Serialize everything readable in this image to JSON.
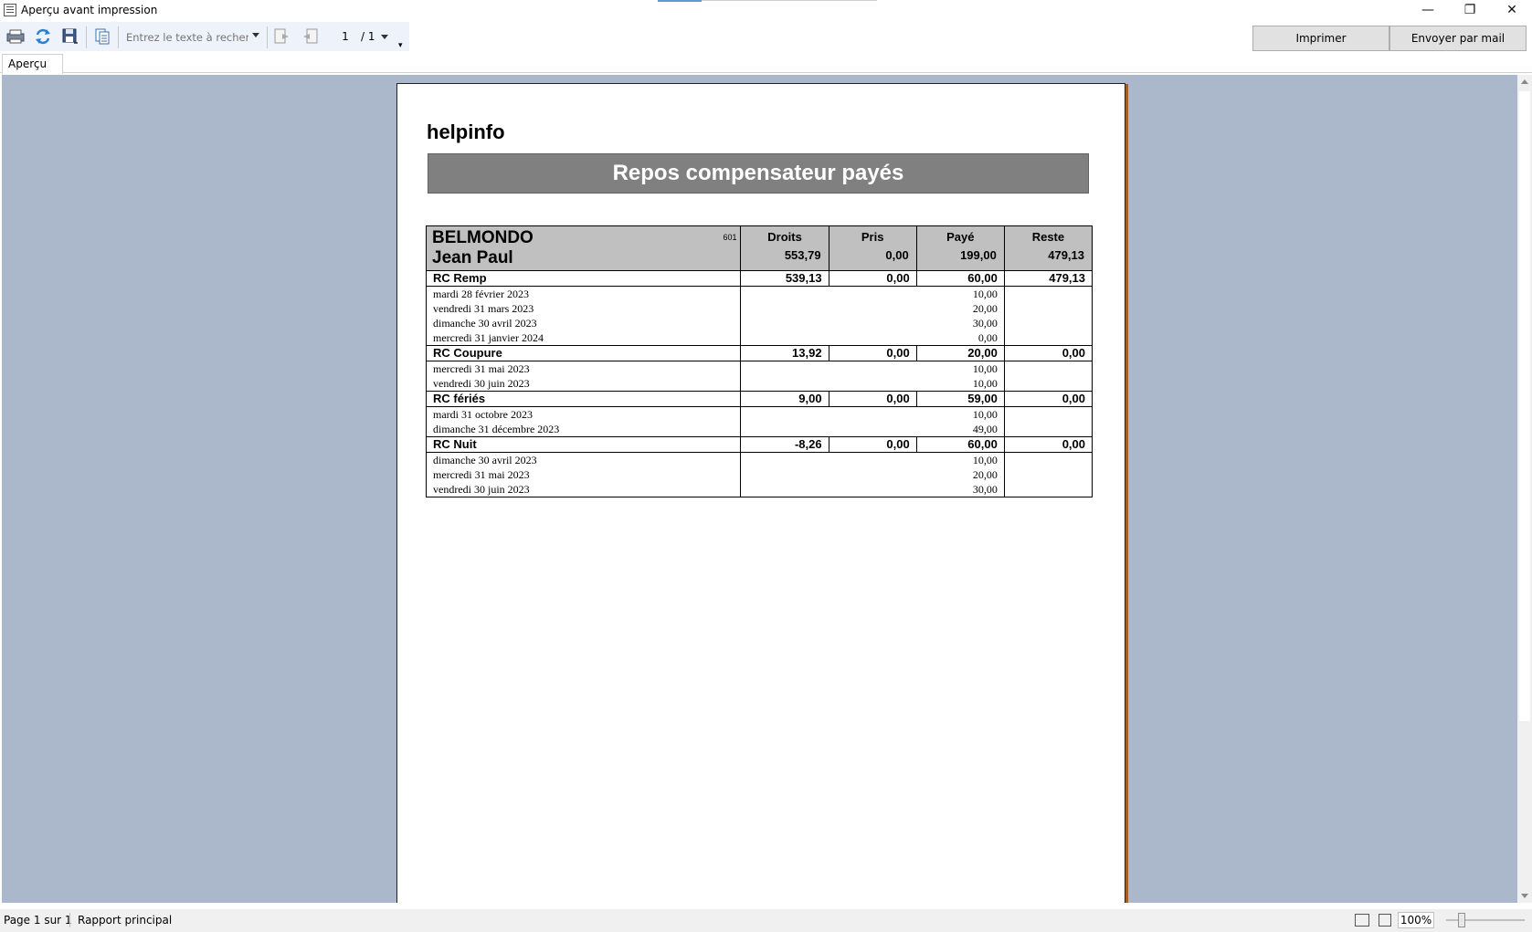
{
  "window": {
    "title": "Aperçu avant impression",
    "minimize_glyph": "—",
    "maximize_glyph": "❐",
    "close_glyph": "✕"
  },
  "toolbar": {
    "search_placeholder": "Entrez le texte à recherch",
    "page_number": "1",
    "page_total": "/ 1",
    "print_label": "Imprimer",
    "mail_label": "Envoyer par mail"
  },
  "tabs": [
    {
      "label": "Aperçu",
      "active": true
    }
  ],
  "report": {
    "company": "helpinfo",
    "title": "Repos compensateur payés",
    "employee": {
      "last_name": "BELMONDO",
      "first_name": "Jean Paul",
      "code": "601"
    },
    "columns": {
      "droits": "Droits",
      "pris": "Pris",
      "paye": "Payé",
      "reste": "Reste"
    },
    "totals": {
      "droits": "553,79",
      "pris": "0,00",
      "paye": "199,00",
      "reste": "479,13"
    },
    "sections": [
      {
        "name": "RC Remp",
        "droits": "539,13",
        "pris": "0,00",
        "paye": "60,00",
        "reste": "479,13",
        "details": [
          {
            "date": "mardi 28 février 2023",
            "paye": "10,00"
          },
          {
            "date": "vendredi 31 mars 2023",
            "paye": "20,00"
          },
          {
            "date": "dimanche 30 avril 2023",
            "paye": "30,00"
          },
          {
            "date": "mercredi 31 janvier 2024",
            "paye": "0,00"
          }
        ]
      },
      {
        "name": "RC Coupure",
        "droits": "13,92",
        "pris": "0,00",
        "paye": "20,00",
        "reste": "0,00",
        "details": [
          {
            "date": "mercredi 31 mai 2023",
            "paye": "10,00"
          },
          {
            "date": "vendredi 30 juin 2023",
            "paye": "10,00"
          }
        ]
      },
      {
        "name": "RC fériés",
        "droits": "9,00",
        "pris": "0,00",
        "paye": "59,00",
        "reste": "0,00",
        "details": [
          {
            "date": "mardi 31 octobre 2023",
            "paye": "10,00"
          },
          {
            "date": "dimanche 31 décembre 2023",
            "paye": "49,00"
          }
        ]
      },
      {
        "name": "RC Nuit",
        "droits": "-8,26",
        "pris": "0,00",
        "paye": "60,00",
        "reste": "0,00",
        "details": [
          {
            "date": "dimanche 30 avril 2023",
            "paye": "10,00"
          },
          {
            "date": "mercredi 31 mai 2023",
            "paye": "20,00"
          },
          {
            "date": "vendredi 30 juin 2023",
            "paye": "30,00"
          }
        ]
      }
    ]
  },
  "statusbar": {
    "page_info": "Page 1 sur 1",
    "report_name": "Rapport principal",
    "zoom": "100%"
  },
  "colors": {
    "preview_background": "#abb8cc",
    "banner_background": "#808080",
    "header_background": "#c0c0c0",
    "toolbar_background": "#eef2fb"
  }
}
